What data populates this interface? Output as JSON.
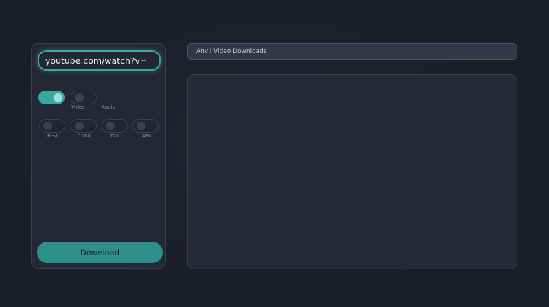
{
  "url_input": {
    "value": "youtube.com/watch?v="
  },
  "mode_toggles": [
    {
      "label": "",
      "on": true
    },
    {
      "label": "Video",
      "on": false
    },
    {
      "label": "Audio",
      "on": false
    }
  ],
  "quality_toggles": [
    {
      "label": "Best",
      "on": false
    },
    {
      "label": "1080",
      "on": false
    },
    {
      "label": "720",
      "on": false
    },
    {
      "label": "480",
      "on": false
    }
  ],
  "download_button": {
    "label": "Download"
  },
  "title_bar": {
    "title": "Anvil Video Downloads"
  },
  "colors": {
    "accent": "#3aa8a0",
    "background": "#1b1d27",
    "panel": "#242734"
  }
}
